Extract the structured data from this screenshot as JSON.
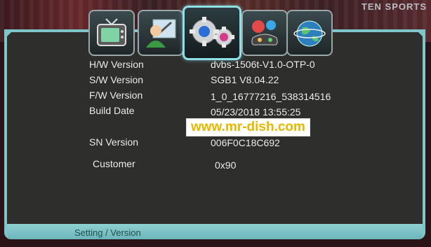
{
  "channel_logo": "TEN SPORTS",
  "tabs": [
    {
      "name": "tv-icon",
      "active": false
    },
    {
      "name": "user-tools-icon",
      "active": false
    },
    {
      "name": "gears-icon",
      "active": true
    },
    {
      "name": "games-icon",
      "active": false
    },
    {
      "name": "globe-icon",
      "active": false
    }
  ],
  "info": {
    "hw_label": "H/W Version",
    "hw_value": "dvbs-1506t-V1.0-OTP-0",
    "sw_label": "S/W Version",
    "sw_value": "SGB1 V8.04.22",
    "fw_label": "F/W Version",
    "fw_value": "1_0_16777216_538314516",
    "build_label": "Build Date",
    "build_value": "05/23/2018 13:55:25",
    "sn_label": "SN Version",
    "sn_value": "006F0C18C692",
    "customer_label": "Customer",
    "customer_value": "0x90"
  },
  "watermark": "www.mr-dish.com",
  "footer": {
    "breadcrumb": "Setting / Version"
  },
  "colors": {
    "panel_border": "#7fc6c9",
    "panel_bg": "#2e2e2c",
    "watermark_text": "#e6b800"
  }
}
